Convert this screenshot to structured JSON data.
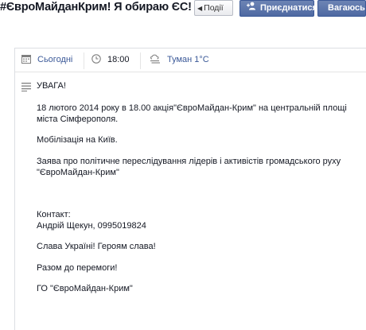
{
  "header": {
    "title": "#ЄвроМайданКрим! Я обираю ЄС!",
    "back_label": "Події",
    "join_label": "Приєднатися",
    "hesitate_label": "Вагаюсь"
  },
  "event_info": {
    "date_label": "Сьогодні",
    "time_label": "18:00",
    "weather_label": "Туман 1°C"
  },
  "description": {
    "paragraphs": [
      "УВАГА!",
      "18 лютого 2014 року в 18.00 акція\"ЄвроМайдан-Крим\" на центральній площі\nміста Сімферополя.",
      "Мобілізація на Київ.",
      "Заява про політичне переслідування лідерів і активістів громадського руху\n\"ЄвроМайдан-Крим\"",
      "Контакт:\nАндрій Щекун, 0995019824",
      "Слава Україні! Героям слава!",
      "Разом до перемоги!",
      "ГО \"ЄвроМайдан-Крим\""
    ]
  },
  "colors": {
    "link": "#3b5998",
    "button": "#4e69a2",
    "text": "#141823"
  }
}
